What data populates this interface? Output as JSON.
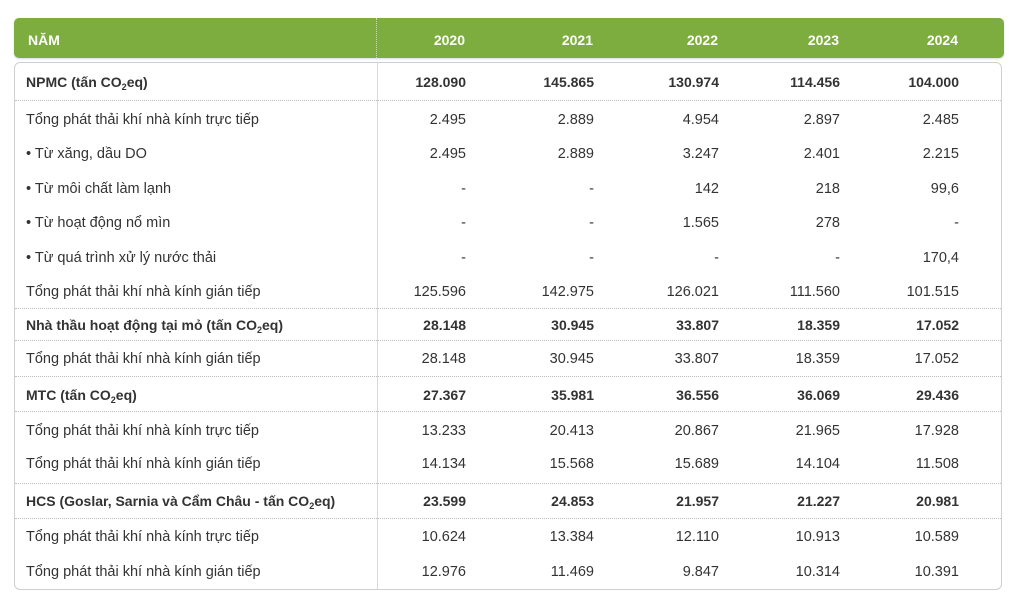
{
  "header": {
    "label": "NĂM",
    "years": [
      "2020",
      "2021",
      "2022",
      "2023",
      "2024"
    ]
  },
  "rows": [
    {
      "pre": "NPMC (tấn CO",
      "sub": "2",
      "post": "eq)",
      "values": [
        "128.090",
        "145.865",
        "130.974",
        "114.456",
        "104.000"
      ]
    },
    {
      "label": "Tổng phát thải khí nhà kính trực tiếp",
      "values": [
        "2.495",
        "2.889",
        "4.954",
        "2.897",
        "2.485"
      ]
    },
    {
      "label": "• Từ xăng, dầu DO",
      "values": [
        "2.495",
        "2.889",
        "3.247",
        "2.401",
        "2.215"
      ]
    },
    {
      "label": "• Từ môi chất làm lạnh",
      "values": [
        "-",
        "-",
        "142",
        "218",
        "99,6"
      ]
    },
    {
      "label": "• Từ hoạt động nổ mìn",
      "values": [
        "-",
        "-",
        "1.565",
        "278",
        "-"
      ]
    },
    {
      "label": "• Từ quá trình xử lý nước thải",
      "values": [
        "-",
        "-",
        "-",
        "-",
        "170,4"
      ]
    },
    {
      "label": "Tổng phát thải khí nhà kính gián tiếp",
      "values": [
        "125.596",
        "142.975",
        "126.021",
        "111.560",
        "101.515"
      ]
    },
    {
      "pre": "Nhà thầu hoạt động tại mỏ (tấn CO",
      "sub": "2",
      "post": "eq)",
      "values": [
        "28.148",
        "30.945",
        "33.807",
        "18.359",
        "17.052"
      ]
    },
    {
      "label": "Tổng phát thải khí nhà kính gián tiếp",
      "values": [
        "28.148",
        "30.945",
        "33.807",
        "18.359",
        "17.052"
      ]
    },
    {
      "pre": "MTC (tấn CO",
      "sub": "2",
      "post": "eq)",
      "values": [
        "27.367",
        "35.981",
        "36.556",
        "36.069",
        "29.436"
      ]
    },
    {
      "label": "Tổng phát thải khí nhà kính trực tiếp",
      "values": [
        "13.233",
        "20.413",
        "20.867",
        "21.965",
        "17.928"
      ]
    },
    {
      "label": "Tổng phát thải khí nhà kính gián tiếp",
      "values": [
        "14.134",
        "15.568",
        "15.689",
        "14.104",
        "11.508"
      ]
    },
    {
      "pre": "HCS (Goslar, Sarnia và Cẩm Châu - tấn CO",
      "sub": "2",
      "post": "eq)",
      "values": [
        "23.599",
        "24.853",
        "21.957",
        "21.227",
        "20.981"
      ]
    },
    {
      "label": "Tổng phát thải khí nhà kính trực tiếp",
      "values": [
        "10.624",
        "13.384",
        "12.110",
        "10.913",
        "10.589"
      ]
    },
    {
      "label": "Tổng phát thải khí nhà kính gián tiếp",
      "values": [
        "12.976",
        "11.469",
        "9.847",
        "10.314",
        "10.391"
      ]
    }
  ]
}
